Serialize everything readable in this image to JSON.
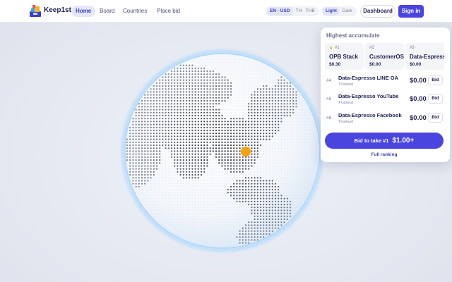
{
  "header": {
    "brand": "Keep1st",
    "nav": [
      "Home",
      "Board",
      "Countries",
      "Place bid"
    ],
    "active_nav": "Home",
    "locale_options": [
      "EN · USD",
      "TH · THB"
    ],
    "theme_options": [
      "Light",
      "Dark"
    ],
    "dashboard_label": "Dashboard",
    "signin_label": "Sign in"
  },
  "globe": {
    "marker_icon": "location-dot",
    "marker_color": "#f5a20c",
    "land_dot_color": "#2a2d3d"
  },
  "panel": {
    "title": "Highest accumulate",
    "top3": [
      {
        "rank": "#1",
        "name": "OPB Stack",
        "price": "$0.30",
        "crown": true
      },
      {
        "rank": "#2",
        "name": "CustomerOS",
        "price": "$0.00",
        "crown": false
      },
      {
        "rank": "#3",
        "name": "Data-Espresso",
        "price": "$0.00",
        "crown": false
      }
    ],
    "rows": [
      {
        "rank": "#4",
        "name": "Data-Espresso LINE OA",
        "country": "Thailand",
        "price": "$0.00",
        "bid": "Bid"
      },
      {
        "rank": "#5",
        "name": "Data-Espresso YouTube",
        "country": "Thailand",
        "price": "$0.00",
        "bid": "Bid"
      },
      {
        "rank": "#6",
        "name": "Data-Espresso Facebook",
        "country": "Thailand",
        "price": "$0.00",
        "bid": "Bid"
      }
    ],
    "bid_button_label": "Bid to take #1",
    "bid_button_amount": "$1.00+",
    "full_ranking_label": "Full ranking"
  },
  "colors": {
    "accent": "#4b45e0",
    "crown": "#f2a70c"
  }
}
